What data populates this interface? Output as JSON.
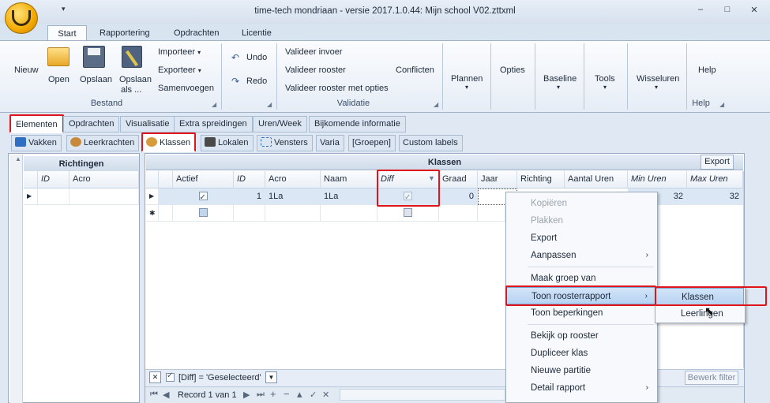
{
  "window": {
    "title": "time-tech mondriaan - versie 2017.1.0.44: Mijn school V02.zttxml",
    "qa_arrow": "▾",
    "min_icon": "‒",
    "max_icon": "□",
    "close_icon": "✕"
  },
  "ribbon_tabs": [
    "Start",
    "Rapportering",
    "Opdrachten",
    "Licentie"
  ],
  "ribbon": {
    "bestand": {
      "nieuw": "Nieuw",
      "open": "Open",
      "opslaan": "Opslaan",
      "opslaan_als_1": "Opslaan",
      "opslaan_als_2": "als ...",
      "importeer": "Importeer",
      "exporteer": "Exporteer",
      "samenvoegen": "Samenvoegen",
      "label": "Bestand"
    },
    "undo": "Undo",
    "redo": "Redo",
    "validatie": {
      "invoer": "Valideer invoer",
      "rooster": "Valideer rooster",
      "opties": "Valideer rooster met opties",
      "conflicten": "Conflicten",
      "label": "Validatie"
    },
    "plannen": "Plannen",
    "opties": "Opties",
    "baseline": "Baseline",
    "tools": "Tools",
    "wisseluren": "Wisseluren",
    "help": "Help",
    "help_label": "Help",
    "dropdown": "▾"
  },
  "element_tabs": [
    "Elementen",
    "Opdrachten",
    "Visualisatie",
    "Extra spreidingen",
    "Uren/Week",
    "Bijkomende informatie"
  ],
  "sub_tabs": [
    "Vakken",
    "Leerkrachten",
    "Klassen",
    "Lokalen",
    "Vensters",
    "Varia",
    "[Groepen]",
    "Custom labels"
  ],
  "left_panel": {
    "title": "Richtingen",
    "columns": [
      "ID",
      "Acro"
    ]
  },
  "main_panel": {
    "title": "Klassen",
    "export": "Export",
    "columns": [
      "Actief",
      "ID",
      "Acro",
      "Naam",
      "Diff",
      "Graad",
      "Jaar",
      "Richting",
      "Aantal Uren",
      "Min Uren",
      "Max Uren"
    ],
    "rows": [
      {
        "actief": true,
        "id": "1",
        "acro": "1La",
        "naam": "1La",
        "diff": true,
        "graad": "0",
        "min": "32",
        "max": "32"
      }
    ]
  },
  "filter": {
    "text": "[Diff] = 'Geselecteerd'",
    "edit": "Bewerk filter"
  },
  "navigator": {
    "record": "Record 1 van 1"
  },
  "context_menu": [
    "Kopiëren",
    "Plakken",
    "Export",
    "Aanpassen",
    "Maak groep van",
    "Toon roosterrapport",
    "Toon beperkingen",
    "Bekijk op rooster",
    "Dupliceer klas",
    "Nieuwe partitie",
    "Detail rapport"
  ],
  "submenu": [
    "Klassen",
    "Leerlingen"
  ],
  "colors": {
    "highlight": "#e0141b",
    "accent": "#b7d3f2"
  }
}
